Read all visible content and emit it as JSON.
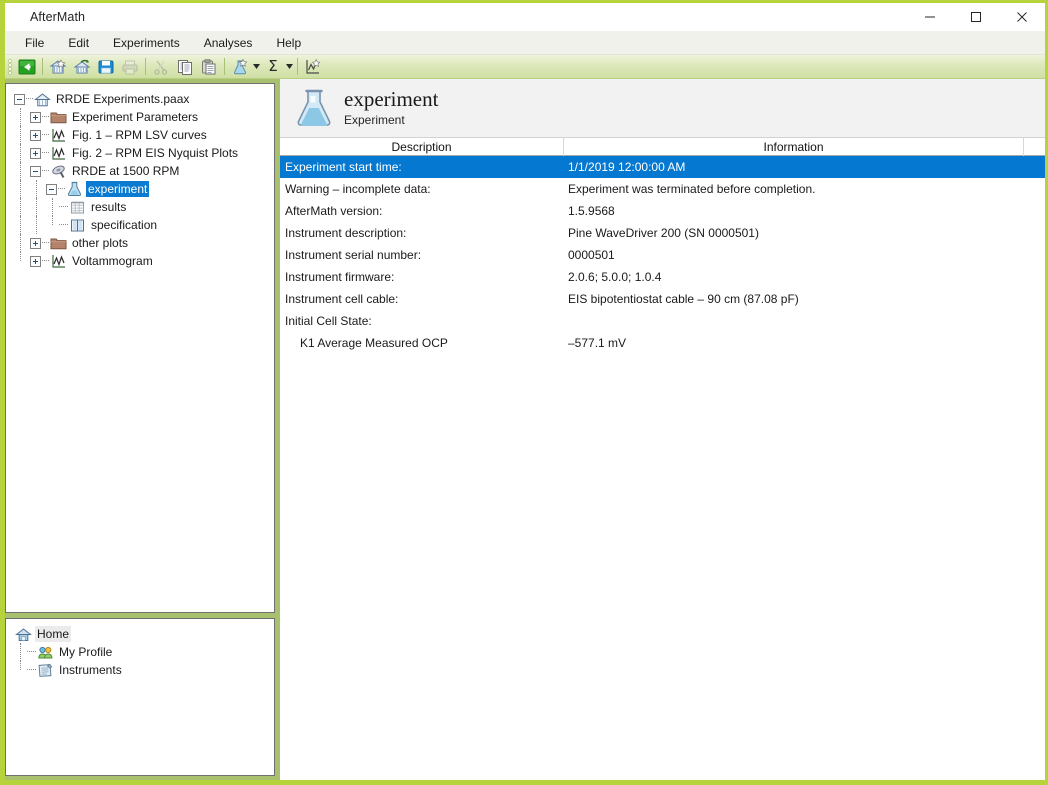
{
  "window": {
    "title": "AfterMath",
    "accent_green": "#b6d33c",
    "selection_blue": "#0579d1",
    "controls": [
      {
        "name": "minimize",
        "glyph": "minimize-icon"
      },
      {
        "name": "maximize",
        "glyph": "maximize-icon"
      },
      {
        "name": "close",
        "glyph": "close-icon"
      }
    ]
  },
  "menubar": {
    "items": [
      {
        "label": "File"
      },
      {
        "label": "Edit"
      },
      {
        "label": "Experiments"
      },
      {
        "label": "Analyses"
      },
      {
        "label": "Help"
      }
    ]
  },
  "toolbar": {
    "buttons": [
      {
        "icon": "back-arrow-icon",
        "enabled": true
      },
      {
        "icon": "new-archive-icon",
        "enabled": true
      },
      {
        "icon": "open-archive-icon",
        "enabled": true
      },
      {
        "icon": "save-icon",
        "enabled": true
      },
      {
        "icon": "print-icon",
        "enabled": false
      },
      {
        "icon": "cut-icon",
        "enabled": false
      },
      {
        "icon": "copy-icon",
        "enabled": true
      },
      {
        "icon": "paste-icon",
        "enabled": true
      },
      {
        "icon": "new-experiment-icon",
        "enabled": true,
        "has_dropdown": true
      },
      {
        "icon": "sigma-analysis-icon",
        "glyph": "Σ",
        "enabled": true,
        "has_dropdown": true
      },
      {
        "icon": "new-plot-icon",
        "enabled": true
      }
    ]
  },
  "tree": {
    "nodes": [
      {
        "label": "RRDE Experiments.paax",
        "icon": "archive-icon",
        "depth": 0,
        "expander": "minus",
        "selected": false
      },
      {
        "label": "Experiment Parameters",
        "icon": "folder-icon",
        "depth": 1,
        "expander": "plus",
        "selected": false
      },
      {
        "label": "Fig. 1 – RPM LSV curves",
        "icon": "plot-icon",
        "depth": 1,
        "expander": "plus",
        "selected": false
      },
      {
        "label": "Fig. 2 – RPM EIS Nyquist Plots",
        "icon": "plot-icon",
        "depth": 1,
        "expander": "plus",
        "selected": false
      },
      {
        "label": "RRDE at 1500 RPM",
        "icon": "rrde-icon",
        "depth": 1,
        "expander": "minus",
        "selected": false
      },
      {
        "label": "experiment",
        "icon": "flask-icon",
        "depth": 2,
        "expander": "minus",
        "selected": true
      },
      {
        "label": "results",
        "icon": "results-grid-icon",
        "depth": 3,
        "expander": "none",
        "selected": false
      },
      {
        "label": "specification",
        "icon": "specification-book-icon",
        "depth": 3,
        "expander": "none",
        "selected": false
      },
      {
        "label": "other plots",
        "icon": "folder-icon",
        "depth": 1,
        "expander": "plus",
        "selected": false
      },
      {
        "label": "Voltammogram",
        "icon": "plot-icon",
        "depth": 1,
        "expander": "plus",
        "selected": false
      }
    ]
  },
  "home_tree": {
    "nodes": [
      {
        "label": "Home",
        "icon": "home-icon",
        "depth": 0,
        "highlight": true
      },
      {
        "label": "My Profile",
        "icon": "profile-icon",
        "depth": 1,
        "highlight": false
      },
      {
        "label": "Instruments",
        "icon": "instruments-icon",
        "depth": 1,
        "highlight": false
      }
    ]
  },
  "content": {
    "header": {
      "icon": "flask-icon",
      "title": "experiment",
      "subtitle": "Experiment"
    },
    "table": {
      "columns": [
        "Description",
        "Information",
        ""
      ],
      "rows": [
        {
          "description": "Experiment start time:",
          "information": "1/1/2019 12:00:00 AM",
          "selected": true,
          "indent": false
        },
        {
          "description": "Warning – incomplete data:",
          "information": "Experiment was terminated before completion.",
          "selected": false,
          "indent": false
        },
        {
          "description": "AfterMath version:",
          "information": "1.5.9568",
          "selected": false,
          "indent": false
        },
        {
          "description": "Instrument description:",
          "information": "Pine WaveDriver 200 (SN 0000501)",
          "selected": false,
          "indent": false
        },
        {
          "description": "Instrument serial number:",
          "information": "0000501",
          "selected": false,
          "indent": false
        },
        {
          "description": "Instrument firmware:",
          "information": "2.0.6; 5.0.0; 1.0.4",
          "selected": false,
          "indent": false
        },
        {
          "description": "Instrument cell cable:",
          "information": "EIS bipotentiostat cable – 90 cm (87.08 pF)",
          "selected": false,
          "indent": false
        },
        {
          "description": "Initial Cell State:",
          "information": "",
          "selected": false,
          "indent": false
        },
        {
          "description": "K1 Average Measured OCP",
          "information": "–577.1 mV",
          "selected": false,
          "indent": true
        }
      ]
    }
  }
}
